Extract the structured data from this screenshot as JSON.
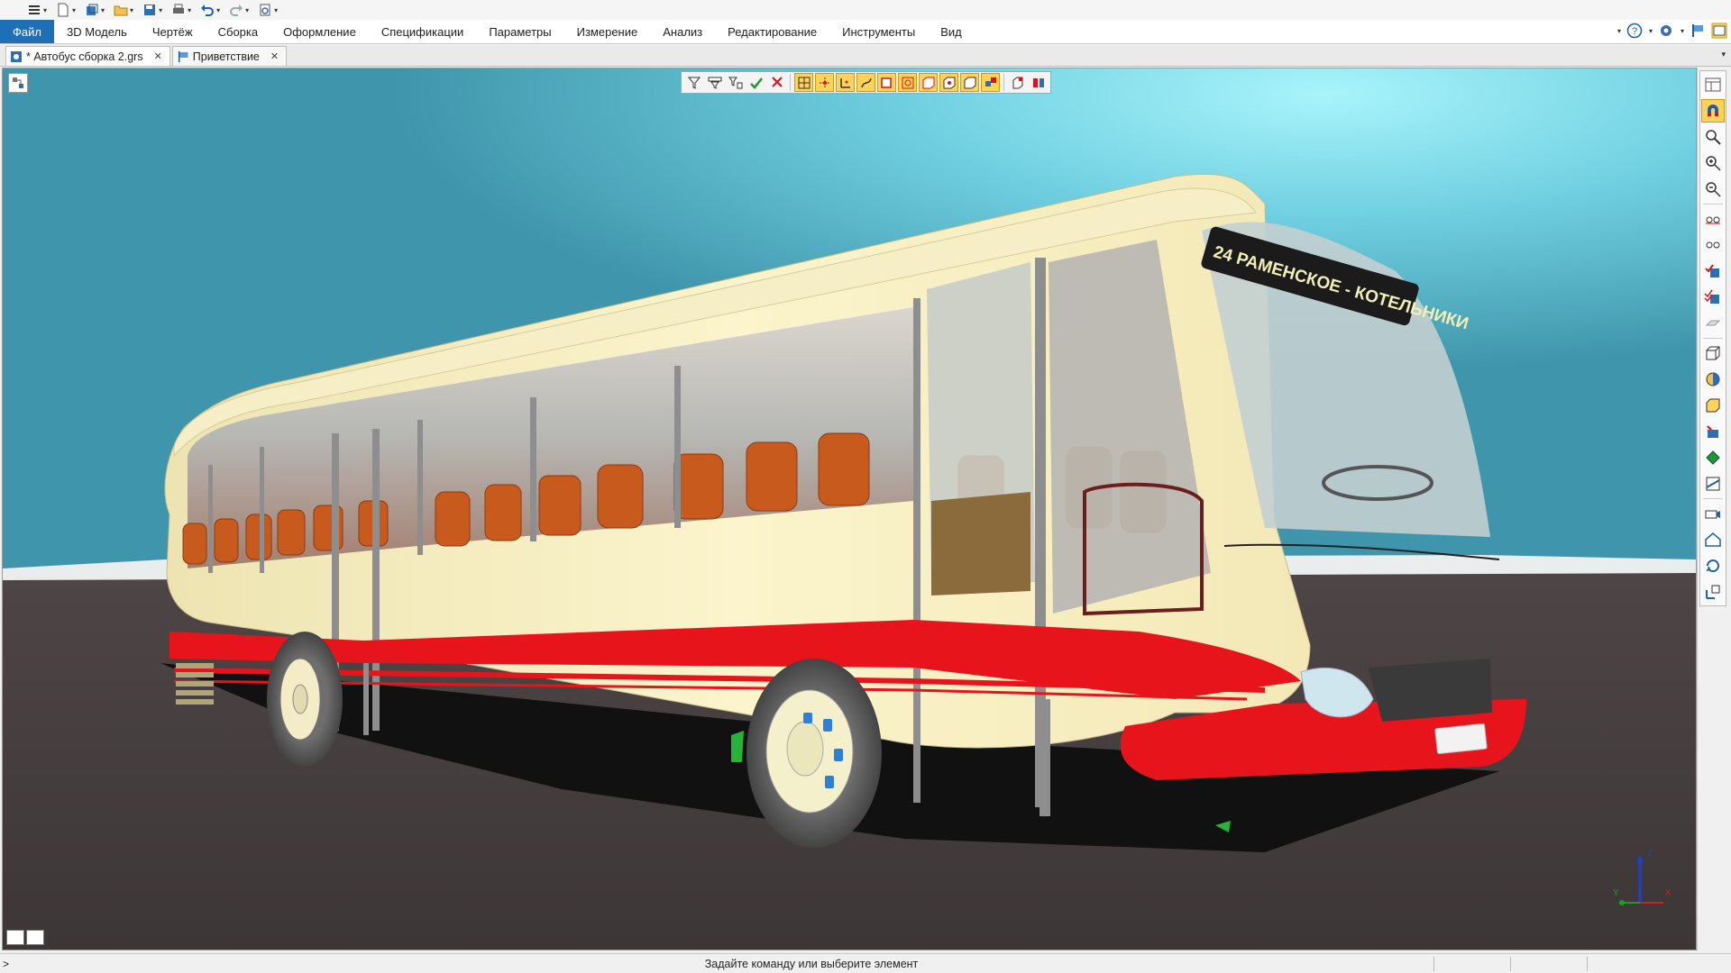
{
  "quick_access": {
    "icons": [
      "hamburger-menu-icon",
      "new-file-icon",
      "open-3d-icon",
      "open-folder-icon",
      "save-icon",
      "print-icon",
      "undo-icon",
      "redo-icon",
      "settings-doc-icon"
    ]
  },
  "menu": {
    "items": [
      {
        "label": "Файл"
      },
      {
        "label": "3D Модель"
      },
      {
        "label": "Чертёж"
      },
      {
        "label": "Сборка"
      },
      {
        "label": "Оформление"
      },
      {
        "label": "Спецификации"
      },
      {
        "label": "Параметры"
      },
      {
        "label": "Измерение"
      },
      {
        "label": "Анализ"
      },
      {
        "label": "Редактирование"
      },
      {
        "label": "Инструменты"
      },
      {
        "label": "Вид"
      }
    ]
  },
  "tabs": [
    {
      "label": "* Автобус сборка 2.grs",
      "active": true
    },
    {
      "label": "Приветствие",
      "active": false
    }
  ],
  "bus": {
    "route_sign": "24  РАМЕНСКОЕ - КОТЕЛЬНИКИ"
  },
  "axes": {
    "z": "Z",
    "y": "Y",
    "x": "X"
  },
  "status": {
    "prompt": ">",
    "message": "Задайте команду или выберите элемент"
  },
  "colors": {
    "accent": "#1e6fb8",
    "highlight": "#ffd25a",
    "bus_body": "#f7f0c2",
    "stripe": "#e8141b",
    "sky": "#4fb3c8",
    "floor": "#463f3f"
  }
}
